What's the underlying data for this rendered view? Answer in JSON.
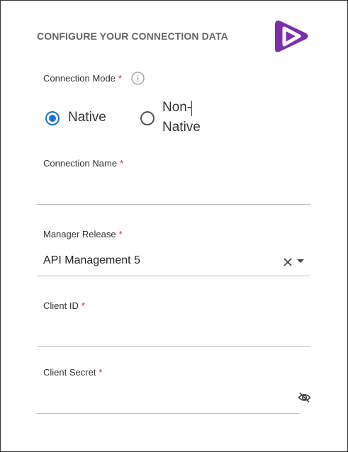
{
  "header": {
    "title": "CONFIGURE YOUR CONNECTION DATA"
  },
  "colors": {
    "accent": "#1a73c8",
    "required": "#e02020",
    "logo": "#7b2fa8"
  },
  "form": {
    "connection_mode": {
      "label": "Connection Mode",
      "required_mark": "*",
      "options": [
        {
          "label": "Native",
          "selected": true
        },
        {
          "label_line1": "Non-",
          "label_line2": "Native",
          "selected": false
        }
      ]
    },
    "connection_name": {
      "label": "Connection Name",
      "required_mark": "*",
      "value": ""
    },
    "manager_release": {
      "label": "Manager Release",
      "required_mark": "*",
      "value": "API Management 5"
    },
    "client_id": {
      "label": "Client ID",
      "required_mark": "*",
      "value": ""
    },
    "client_secret": {
      "label": "Client Secret",
      "required_mark": "*",
      "value": ""
    }
  },
  "icons": {
    "logo": "play-logo-icon",
    "info": "info-icon",
    "clear": "clear-icon",
    "caret": "chevron-down-icon",
    "visibility": "eye-off-icon"
  }
}
